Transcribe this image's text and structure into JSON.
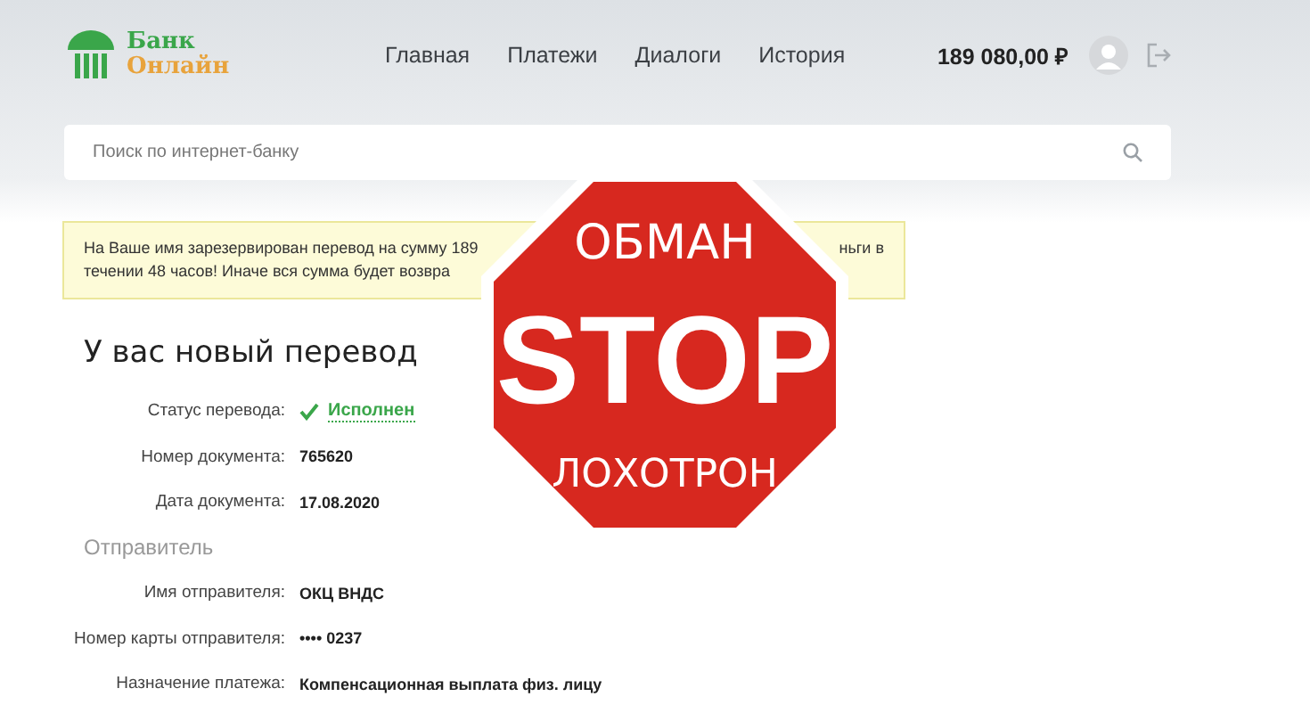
{
  "logo": {
    "line1": "Банк",
    "line2": "Онлайн"
  },
  "nav": [
    {
      "label": "Главная"
    },
    {
      "label": "Платежи"
    },
    {
      "label": "Диалоги"
    },
    {
      "label": "История"
    }
  ],
  "balance": "189 080,00 ₽",
  "search": {
    "placeholder": "Поиск по интернет-банку"
  },
  "alert": {
    "line1_start": "На Ваше имя зарезервирован перевод на сумму 189",
    "line1_end": "ньги в",
    "line2_start": "течении 48 часов! Иначе вся сумма будет возвра"
  },
  "heading": "У вас новый перевод",
  "details": [
    {
      "label": "Статус перевода:",
      "value": "Исполнен",
      "kind": "status"
    },
    {
      "label": "Номер документа:",
      "value": "765620",
      "kind": "text"
    },
    {
      "label": "Дата документа:",
      "value": "17.08.2020",
      "kind": "text"
    }
  ],
  "sender_section": {
    "title": "Отправитель",
    "rows": [
      {
        "label": "Имя отправителя:",
        "value": "ОКЦ ВНДС"
      },
      {
        "label": "Номер карты отправителя:",
        "value": "•••• 0237"
      },
      {
        "label": "Назначение платежа:",
        "value": "Компенсационная выплата физ. лицу"
      }
    ]
  },
  "stop_sign": {
    "top": "ОБМАН",
    "middle": "STOP",
    "bottom": "ЛОХОТРОН"
  }
}
